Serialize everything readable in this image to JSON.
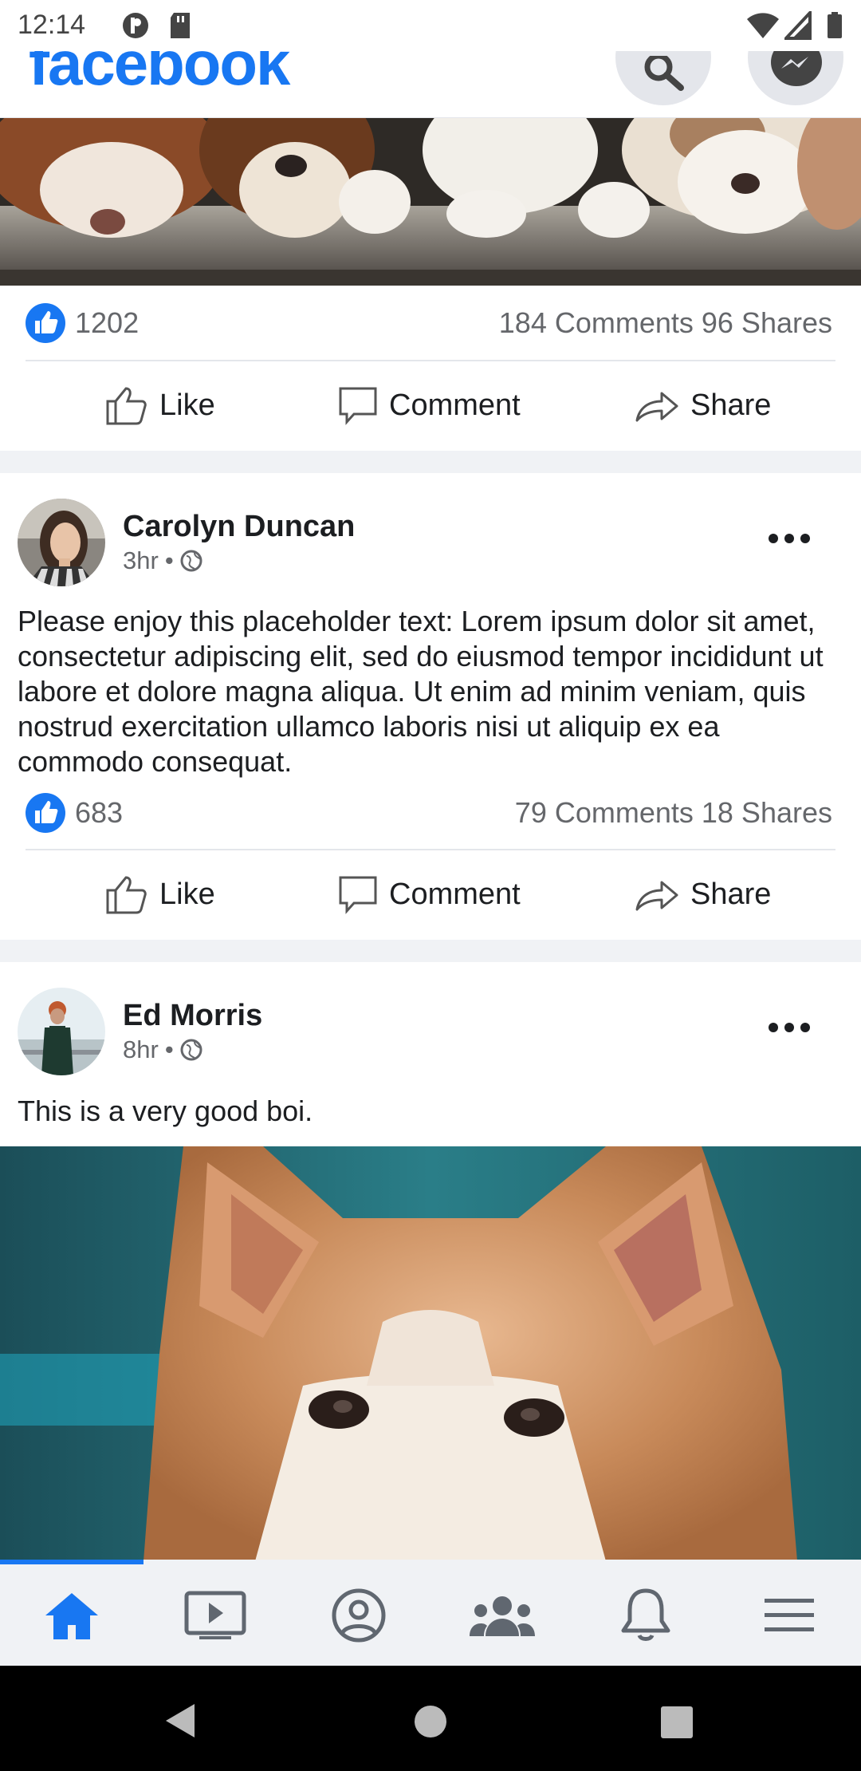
{
  "status_bar": {
    "time": "12:14"
  },
  "app": {
    "logo": "facebook"
  },
  "posts": [
    {
      "likes": "1202",
      "comments_shares": "184 Comments 96 Shares",
      "actions": {
        "like": "Like",
        "comment": "Comment",
        "share": "Share"
      }
    },
    {
      "author": "Carolyn Duncan",
      "time": "3hr",
      "text": "Please enjoy this placeholder text: Lorem ipsum dolor sit amet, consectetur adipiscing elit, sed do eiusmod tempor incididunt ut labore et dolore magna aliqua. Ut enim ad minim veniam, quis nostrud exercitation ullamco laboris nisi ut aliquip ex ea commodo consequat.",
      "likes": "683",
      "comments_shares": "79 Comments 18 Shares",
      "actions": {
        "like": "Like",
        "comment": "Comment",
        "share": "Share"
      }
    },
    {
      "author": "Ed Morris",
      "time": "8hr",
      "text": "This is a very good boi."
    }
  ],
  "bottom_nav": [
    "home-icon",
    "video-icon",
    "profile-icon",
    "groups-icon",
    "bell-icon",
    "menu-icon"
  ],
  "colors": {
    "accent": "#1877f2",
    "secondary_text": "#65676b",
    "divider": "#e4e6eb",
    "nav_bg": "#f0f2f5"
  }
}
